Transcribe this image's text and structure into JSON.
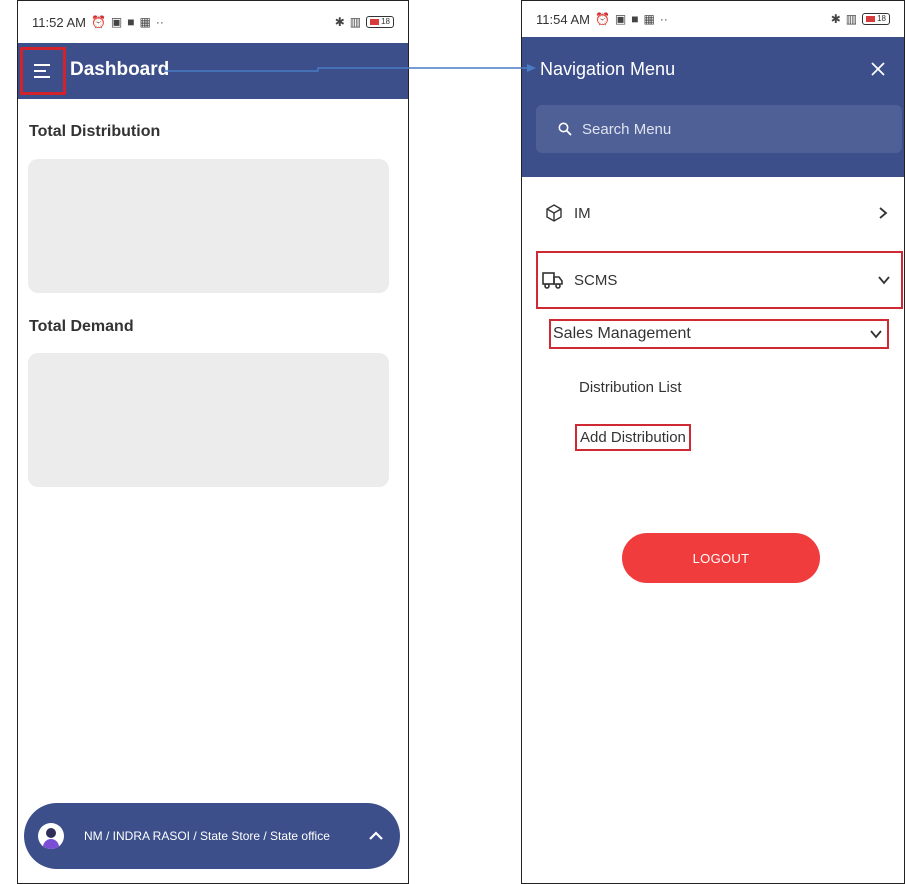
{
  "left_screen": {
    "status": {
      "time": "11:52 AM",
      "battery": "18"
    },
    "appbar": {
      "title": "Dashboard",
      "menu_icon": "hamburger-icon"
    },
    "sections": [
      {
        "title": "Total Distribution"
      },
      {
        "title": "Total Demand"
      }
    ],
    "user_bar": {
      "text": "NM / INDRA RASOI / State Store / State office"
    }
  },
  "right_screen": {
    "status": {
      "time": "11:54 AM",
      "battery": "18"
    },
    "nav": {
      "title": "Navigation Menu",
      "search_placeholder": "Search Menu",
      "items": [
        {
          "label": "IM",
          "icon": "box-icon"
        },
        {
          "label": "SCMS",
          "icon": "truck-icon"
        }
      ],
      "submenu": {
        "label": "Sales Management"
      },
      "links": [
        {
          "label": "Distribution List"
        },
        {
          "label": "Add Distribution"
        }
      ],
      "logout_label": "LOGOUT"
    }
  },
  "colors": {
    "header": "#3c4f8a",
    "highlight": "#cf2a33",
    "logout": "#f03c3c",
    "card": "#ececec",
    "arrow": "#4a7bc4"
  }
}
